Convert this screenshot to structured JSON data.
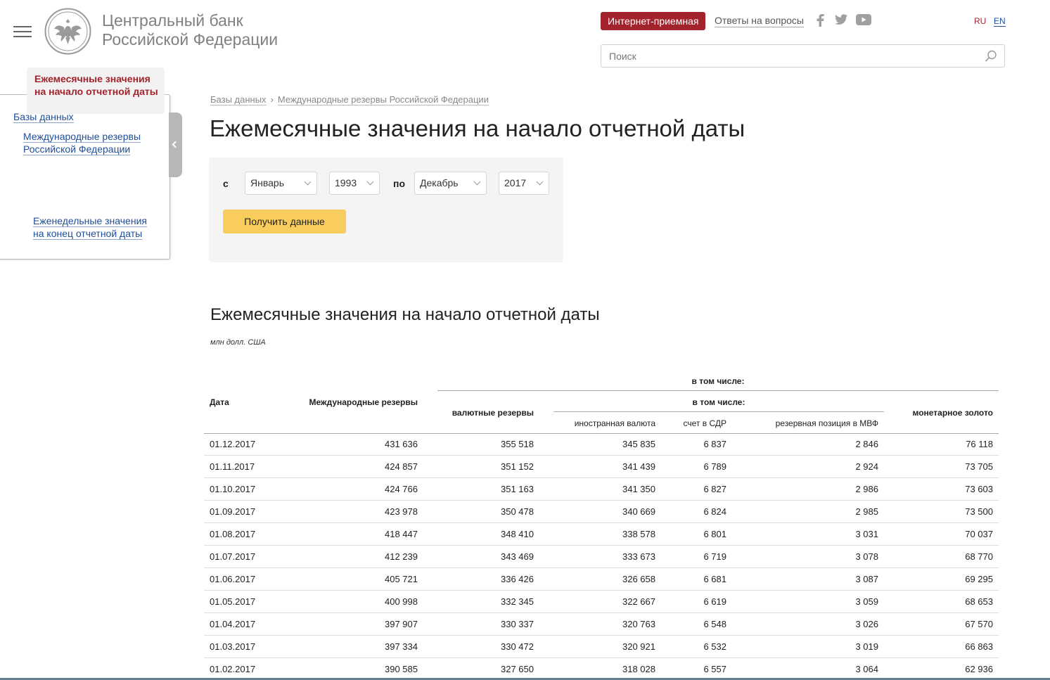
{
  "header": {
    "bank_name_line1": "Центральный банк",
    "bank_name_line2": "Российской Федерации",
    "reception_button": "Интернет-приемная",
    "faq_link": "Ответы на вопросы",
    "lang_ru": "RU",
    "lang_en": "EN",
    "search_placeholder": "Поиск",
    "social_icons": [
      "facebook-icon",
      "twitter-icon",
      "youtube-icon"
    ]
  },
  "sidebar": {
    "root": "Базы данных",
    "parent": "Международные резервы Российской Федерации",
    "active": "Ежемесячные значения на начало отчетной даты",
    "other": "Еженедельные значения на конец отчетной даты"
  },
  "breadcrumb": [
    "Базы данных",
    "Международные резервы Российской Федерации"
  ],
  "page_title": "Ежемесячные значения на начало отчетной даты",
  "filter": {
    "from_label": "с",
    "to_label": "по",
    "from_month": "Январь",
    "from_year": "1993",
    "to_month": "Декабрь",
    "to_year": "2017",
    "submit": "Получить данные"
  },
  "table": {
    "title": "Ежемесячные значения на начало отчетной даты",
    "unit": "млн долл. США",
    "headers": {
      "date": "Дата",
      "reserves": "Международные резервы",
      "incl_top": "в том числе:",
      "fx_reserves": "валютные резервы",
      "incl_sub": "в том числе:",
      "foreign_currency": "иностранная валюта",
      "sdr": "счет в СДР",
      "imf_position": "резервная позиция в МВФ",
      "gold": "монетарное золото"
    },
    "rows": [
      [
        "01.12.2017",
        "431 636",
        "355 518",
        "345 835",
        "6 837",
        "2 846",
        "76 118"
      ],
      [
        "01.11.2017",
        "424 857",
        "351 152",
        "341 439",
        "6 789",
        "2 924",
        "73 705"
      ],
      [
        "01.10.2017",
        "424 766",
        "351 163",
        "341 350",
        "6 827",
        "2 986",
        "73 603"
      ],
      [
        "01.09.2017",
        "423 978",
        "350 478",
        "340 669",
        "6 824",
        "2 985",
        "73 500"
      ],
      [
        "01.08.2017",
        "418 447",
        "348 410",
        "338 578",
        "6 801",
        "3 031",
        "70 037"
      ],
      [
        "01.07.2017",
        "412 239",
        "343 469",
        "333 673",
        "6 719",
        "3 078",
        "68 770"
      ],
      [
        "01.06.2017",
        "405 721",
        "336 426",
        "326 658",
        "6 681",
        "3 087",
        "69 295"
      ],
      [
        "01.05.2017",
        "400 998",
        "332 345",
        "322 667",
        "6 619",
        "3 059",
        "68 653"
      ],
      [
        "01.04.2017",
        "397 907",
        "330 337",
        "320 763",
        "6 548",
        "3 026",
        "67 570"
      ],
      [
        "01.03.2017",
        "397 334",
        "330 472",
        "320 921",
        "6 532",
        "3 019",
        "66 863"
      ],
      [
        "01.02.2017",
        "390 585",
        "327 650",
        "318 028",
        "6 557",
        "3 064",
        "62 936"
      ]
    ]
  }
}
